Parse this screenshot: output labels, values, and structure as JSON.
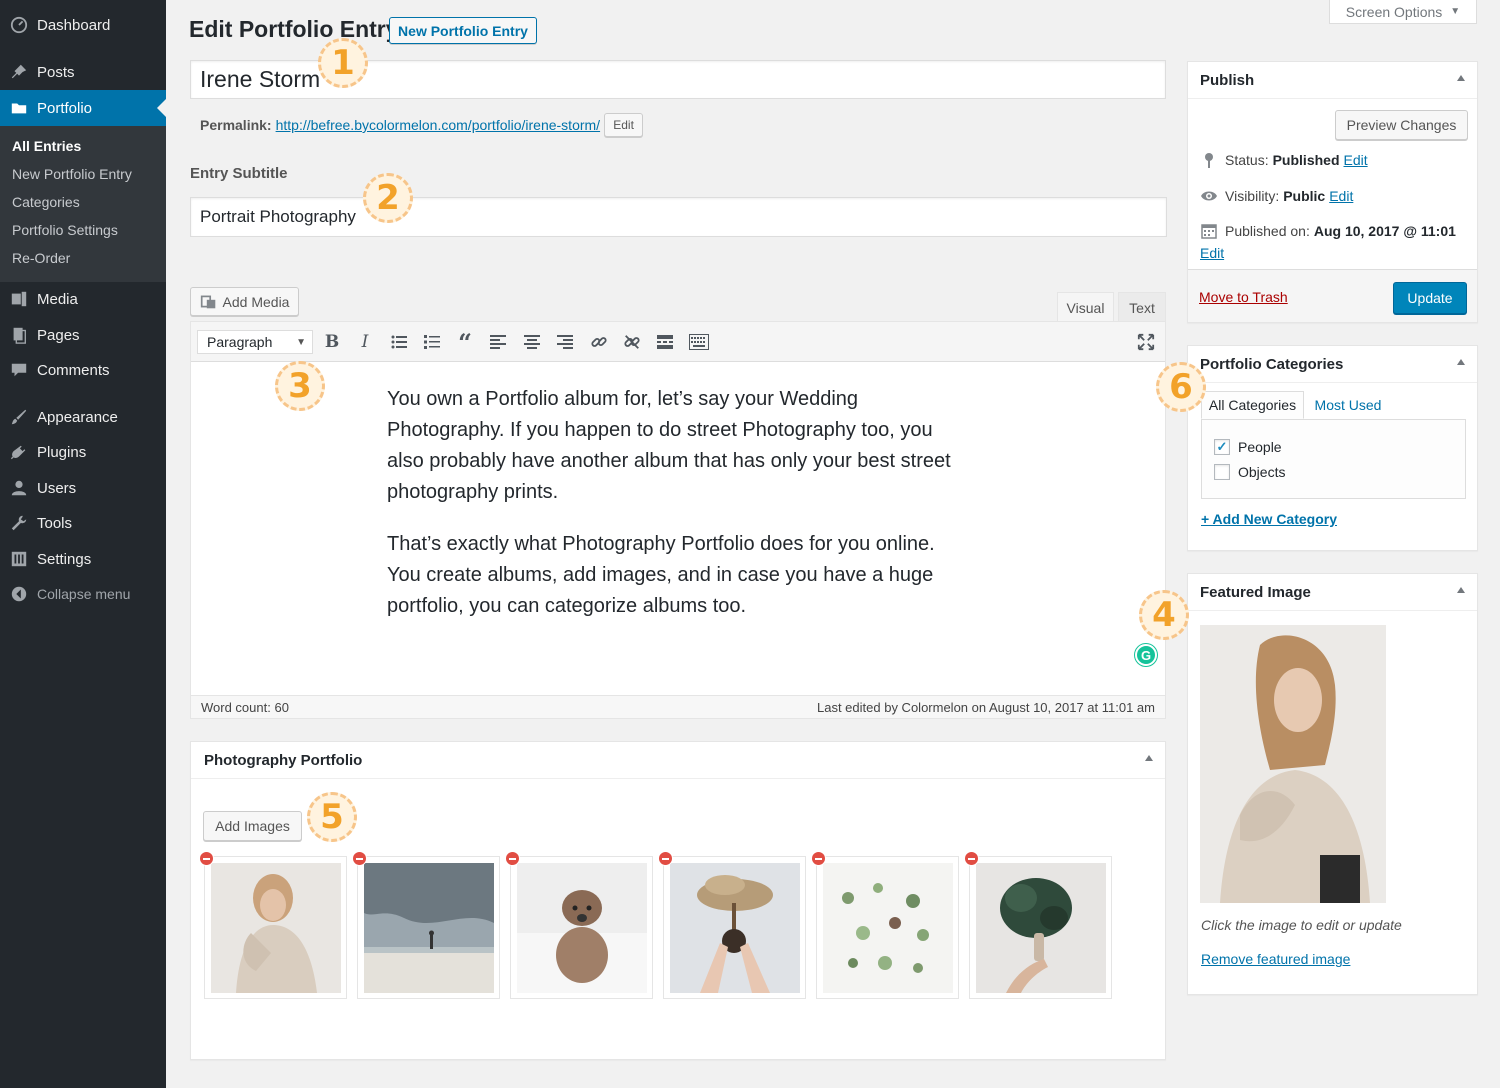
{
  "sidebar": {
    "items": [
      {
        "label": "Dashboard",
        "icon": "dashboard-icon"
      },
      {
        "label": "Posts",
        "icon": "pin-icon"
      },
      {
        "label": "Portfolio",
        "icon": "folder-icon"
      },
      {
        "label": "Media",
        "icon": "media-icon"
      },
      {
        "label": "Pages",
        "icon": "pages-icon"
      },
      {
        "label": "Comments",
        "icon": "comment-icon"
      },
      {
        "label": "Appearance",
        "icon": "brush-icon"
      },
      {
        "label": "Plugins",
        "icon": "plug-icon"
      },
      {
        "label": "Users",
        "icon": "user-icon"
      },
      {
        "label": "Tools",
        "icon": "wrench-icon"
      },
      {
        "label": "Settings",
        "icon": "settings-icon"
      }
    ],
    "submenu": [
      "All Entries",
      "New Portfolio Entry",
      "Categories",
      "Portfolio Settings",
      "Re-Order"
    ],
    "collapse_label": "Collapse menu"
  },
  "header": {
    "title": "Edit Portfolio Entry",
    "new_button": "New Portfolio Entry",
    "screen_options": "Screen Options"
  },
  "entry": {
    "title": "Irene Storm",
    "permalink_label": "Permalink:",
    "permalink_url": "http://befree.bycolormelon.com/portfolio/irene-storm/",
    "permalink_edit": "Edit",
    "subtitle_label": "Entry Subtitle",
    "subtitle": "Portrait Photography"
  },
  "editor": {
    "add_media": "Add Media",
    "tab_visual": "Visual",
    "tab_text": "Text",
    "format": "Paragraph",
    "paragraphs": [
      "You own a Portfolio album for, let’s say your Wedding Photography. If you happen to do street Photography too, you also probably have another album that has only your best street photography prints.",
      "That’s exactly what Photography Portfolio does for you online. You create albums, add images, and in case you have a huge portfolio, you can categorize albums too."
    ],
    "word_count": "Word count: 60",
    "last_edited": "Last edited by Colormelon on August 10, 2017 at 11:01 am"
  },
  "portfolio": {
    "title": "Photography Portfolio",
    "add_images": "Add Images"
  },
  "publish": {
    "title": "Publish",
    "preview": "Preview Changes",
    "status_label": "Status:",
    "status_value": "Published",
    "visibility_label": "Visibility:",
    "visibility_value": "Public",
    "published_label": "Published on:",
    "published_value": "Aug 10, 2017 @ 11:01",
    "edit_label": "Edit",
    "trash": "Move to Trash",
    "update": "Update"
  },
  "categories": {
    "title": "Portfolio Categories",
    "tab_all": "All Categories",
    "tab_used": "Most Used",
    "items": [
      {
        "label": "People",
        "checked": true
      },
      {
        "label": "Objects",
        "checked": false
      }
    ],
    "add_new": "+ Add New Category"
  },
  "featured": {
    "title": "Featured Image",
    "hint": "Click the image to edit or update",
    "remove": "Remove featured image"
  },
  "badges": [
    "1",
    "2",
    "3",
    "4",
    "5",
    "6"
  ],
  "colors": {
    "accent": "#0073aa",
    "sidebar": "#23282d",
    "update": "#0085ba",
    "badge": "#f2a22a"
  }
}
